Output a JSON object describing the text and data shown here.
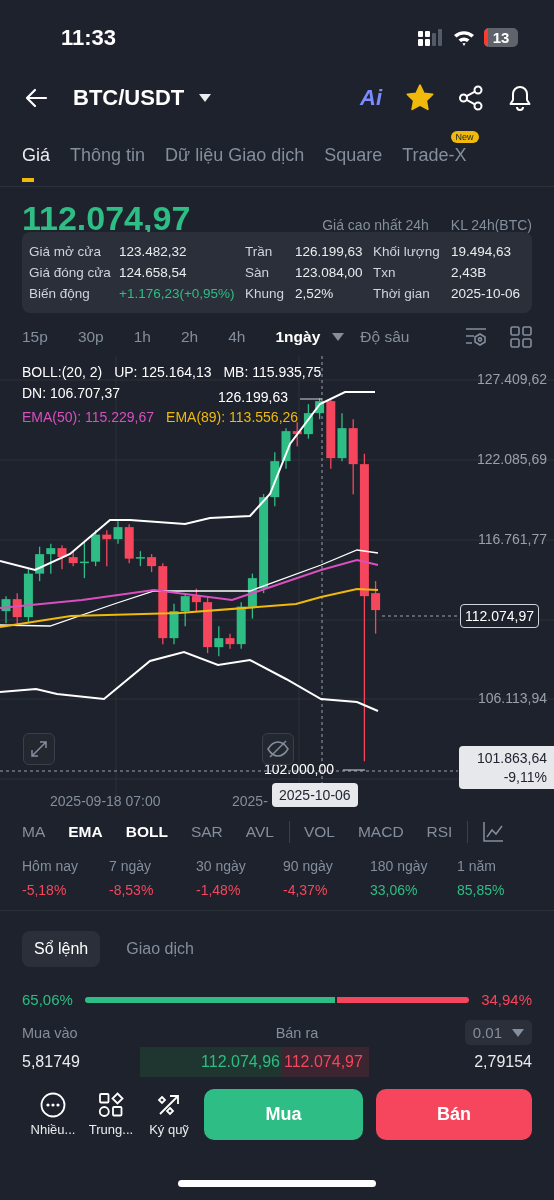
{
  "status_bar": {
    "time": "11:33",
    "battery": "13"
  },
  "header": {
    "pair": "BTC/USDT",
    "ai_label": "Ai",
    "favorite": true
  },
  "tabs": [
    {
      "label": "Giá",
      "selected": true
    },
    {
      "label": "Thông tin",
      "selected": false
    },
    {
      "label": "Dữ liệu Giao dịch",
      "selected": false
    },
    {
      "label": "Square",
      "selected": false
    },
    {
      "label": "Trade-X",
      "selected": false,
      "badge": "New"
    }
  ],
  "ticker": {
    "last_price": "112.074,97",
    "high_24h_label": "Giá cao nhất 24h",
    "volume_24h_label": "KL 24h(BTC)"
  },
  "candle_details": [
    {
      "label": "Giá mở cửa",
      "value": "123.482,32",
      "color": "#eaecef"
    },
    {
      "label": "Trần",
      "value": "126.199,63",
      "color": "#eaecef"
    },
    {
      "label": "Khối lượng",
      "value": "19.494,63",
      "color": "#eaecef"
    },
    {
      "label": "Giá đóng cửa",
      "value": "124.658,54",
      "color": "#eaecef"
    },
    {
      "label": "Sàn",
      "value": "123.084,00",
      "color": "#eaecef"
    },
    {
      "label": "Txn",
      "value": "2,43B",
      "color": "#eaecef"
    },
    {
      "label": "Biến động",
      "value": "+1.176,23(+0,95%)",
      "color": "#2ebd85"
    },
    {
      "label": "Khung",
      "value": "2,52%",
      "color": "#eaecef"
    },
    {
      "label": "Thời gian",
      "value": "2025-10-06",
      "color": "#eaecef"
    }
  ],
  "intervals": [
    {
      "label": "15p",
      "selected": false
    },
    {
      "label": "30p",
      "selected": false
    },
    {
      "label": "1h",
      "selected": false
    },
    {
      "label": "2h",
      "selected": false
    },
    {
      "label": "4h",
      "selected": false
    },
    {
      "label": "1ngày",
      "selected": true
    }
  ],
  "depth_label": "Độ sâu",
  "chart": {
    "legend": [
      [
        {
          "text": "BOLL:(20, 2)",
          "color": "#ffffff"
        },
        {
          "text": "UP: 125.164,13",
          "color": "#ffffff"
        },
        {
          "text": "MB: 115.935,75",
          "color": "#ffffff"
        }
      ],
      [
        {
          "text": "DN: 106.707,37",
          "color": "#ffffff"
        }
      ],
      [
        {
          "text": "EMA(50): 115.229,67",
          "color": "#d94fc0"
        },
        {
          "text": "EMA(89): 113.556,26",
          "color": "#f0b90b"
        }
      ]
    ],
    "price_axis": [
      "127.409,62",
      "122.085,69",
      "116.761,77",
      "106.113,94"
    ],
    "high_marker": "126.199,63",
    "low_marker": "102.000,00",
    "last_price_tag": "112.074,97",
    "crosshair_price": "101.863,64",
    "crosshair_change": "-9,11%",
    "time_axis": [
      "2025-09-18 07:00",
      "2025-"
    ],
    "crosshair_time": "2025-10-06"
  },
  "overlay_indicators": [
    {
      "label": "MA",
      "selected": false
    },
    {
      "label": "EMA",
      "selected": true
    },
    {
      "label": "BOLL",
      "selected": true
    },
    {
      "label": "SAR",
      "selected": false
    },
    {
      "label": "AVL",
      "selected": false
    }
  ],
  "sub_indicators": [
    {
      "label": "VOL",
      "selected": false
    },
    {
      "label": "MACD",
      "selected": false
    },
    {
      "label": "RSI",
      "selected": false
    }
  ],
  "performance": [
    {
      "period": "Hôm nay",
      "change": "-5,18%",
      "color": "#f6465d"
    },
    {
      "period": "7 ngày",
      "change": "-8,53%",
      "color": "#f6465d"
    },
    {
      "period": "30 ngày",
      "change": "-1,48%",
      "color": "#f6465d"
    },
    {
      "period": "90 ngày",
      "change": "-4,37%",
      "color": "#f6465d"
    },
    {
      "period": "180 ngày",
      "change": "33,06%",
      "color": "#2ebd85"
    },
    {
      "period": "1 năm",
      "change": "85,85%",
      "color": "#2ebd85"
    }
  ],
  "book_tabs": [
    {
      "label": "Sổ lệnh",
      "selected": true
    },
    {
      "label": "Giao dịch",
      "selected": false
    }
  ],
  "order_ratio": {
    "buy": "65,06%",
    "sell": "34,94%",
    "level": 0.6506
  },
  "order_book": {
    "bid_header": "Mua vào",
    "ask_header": "Bán ra",
    "precision": "0.01",
    "rows": [
      {
        "bid_qty": "5,81749",
        "bid_price": "112.074,96",
        "ask_price": "112.074,97",
        "ask_qty": "2,79154"
      }
    ]
  },
  "actions": [
    {
      "kind": "more",
      "label": "Nhiều..."
    },
    {
      "kind": "grid",
      "label": "Trung..."
    },
    {
      "kind": "margin",
      "label": "Ký quỹ"
    }
  ],
  "buy_label": "Mua",
  "sell_label": "Bán"
}
